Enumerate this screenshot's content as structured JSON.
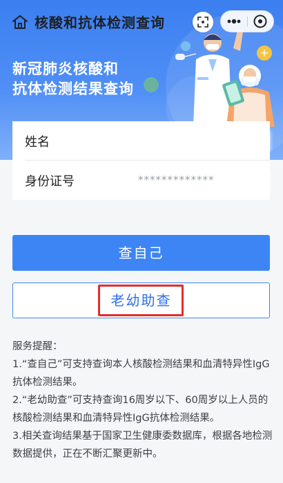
{
  "header": {
    "title": "核酸和抗体检测查询",
    "home_icon": "home-icon",
    "scan_icon": "scan-icon",
    "more_icon": "more-icon",
    "close_icon": "close-icon"
  },
  "hero": {
    "title_line1": "新冠肺炎核酸和",
    "title_line2": "抗体检测结果查询"
  },
  "form": {
    "name_label": "姓名",
    "name_value": "",
    "id_label": "身份证号",
    "id_value": "*************"
  },
  "buttons": {
    "self_query": "查自己",
    "family_query": "老幼助查"
  },
  "notes": {
    "title": "服务提醒：",
    "items": [
      "1.“查自己”可支持查询本人核酸检测结果和血清特异性IgG抗体检测结果。",
      "2.“老幼助查”可支持查询16周岁以下、60周岁以上人员的核酸检测结果和血清特异性IgG抗体检测结果。",
      "3.相关查询结果基于国家卫生健康委数据库，根据各地检测数据提供，正在不断汇聚更新中。"
    ]
  },
  "colors": {
    "primary": "#3d85f5",
    "header_gradient_top": "#3b7ff0",
    "highlight": "#e02c2c"
  }
}
